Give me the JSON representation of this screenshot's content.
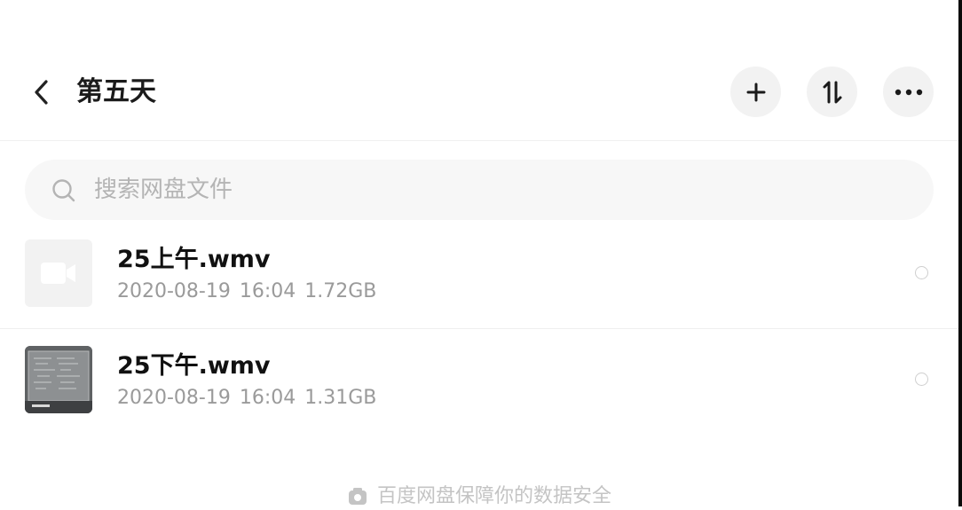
{
  "header": {
    "title": "第五天",
    "back_icon": "chevron-left-icon",
    "buttons": [
      {
        "icon": "plus-icon"
      },
      {
        "icon": "sort-icon"
      },
      {
        "icon": "more-icon"
      }
    ]
  },
  "search": {
    "placeholder": "搜索网盘文件",
    "icon": "search-icon"
  },
  "files": [
    {
      "name": "25上午.wmv",
      "date": "2020-08-19",
      "time": "16:04",
      "size": "1.72GB",
      "thumb": "video-icon"
    },
    {
      "name": "25下午.wmv",
      "date": "2020-08-19",
      "time": "16:04",
      "size": "1.31GB",
      "thumb": "whiteboard-thumbnail"
    }
  ],
  "footer": {
    "text": "百度网盘保障你的数据安全",
    "icon": "shield-icon"
  },
  "colors": {
    "background": "#ffffff",
    "button_bg": "#f2f2f2",
    "search_bg": "#f7f7f7",
    "text_primary": "#111111",
    "text_secondary": "#9a9a9a",
    "placeholder": "#b4b4b4"
  }
}
